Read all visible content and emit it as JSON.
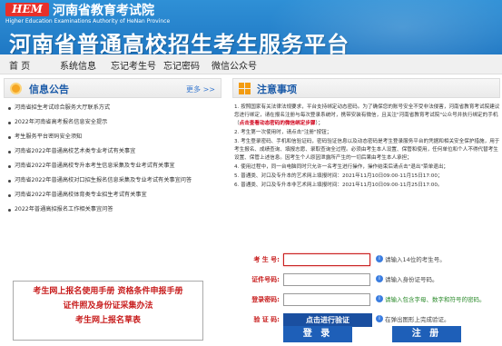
{
  "header": {
    "logo_text": "HEM",
    "org_name": "河南省教育考试院",
    "org_name_en": "Higher Education Examinations Authority of HeNan Province",
    "platform_title": "河南省普通高校招生考生服务平台"
  },
  "nav": {
    "items": [
      "首 页",
      "系统信息",
      "忘记考生号",
      "忘记密码",
      "微信公众号"
    ]
  },
  "announcements": {
    "title": "信息公告",
    "more": "更多 >>",
    "items": [
      "河南省招生考试综合服务大厅联系方式",
      "2022年河南省高考报名信息安全提示",
      "考生服务平台密码安全须知",
      "河南省2022年普通高校艺术类专业考试有关事宜",
      "河南省2022年普通高校专升本考生信息采集及专业考试有关事宜",
      "河南省2022年普通高校对口招生报名信息采集及专业考试有关事宜问答",
      "河南省2022年普通高校体育类专业招生考试有关事宜",
      "2022年普通高招报名工作相关事宜问答"
    ]
  },
  "links": {
    "line1": "考生网上报名使用手册  资格条件申报手册",
    "line2": "证件照及身份证采集办法",
    "line3": "考生网上报名草表"
  },
  "notes": {
    "title": "注意事项",
    "n1_pre": "1. 按照国家有关法律法规要求，平台支持绑定动态密码。为了确保您的账号安全不受非法侵害，河南省教育考试院建议您进行绑定，请在报名注册与每次登录系统时，携带安装有微信，且关注\"河南省教育考试院\"公众号并执行绑定的手机（",
    "n1_red": "点击查看动态密码的微信绑定步骤",
    "n1_post": "）；",
    "n2": "2. 考生第一次使用时，请点击\"注册\"按钮；",
    "n3": "3. 考生登录密码、手机和信验证码，密码验证信息以及动态密码是考生登录服务平台的凭据和相关安全保护措施，用于考生报名、成绩查询、填报志愿、录取查询全过程。必须由考生本人设置、保管和使用，任何单位和个人不得代替考生设置、保管上述信息。因考生个人原因泄露所产生的一切后果由考生本人承担；",
    "n4": "4. 使用过程中，同一台电脑同时只允许一名考生进行操作，操作结束后请点击\"退出\"菜单退出；",
    "n5": "5. 普通类、对口及专升本的艺术网上填报时间：2021年11月10日09:00-11月15日17:00；",
    "n6": "6. 普通类、对口及专升本非艺术网上填报时间：2021年11月10日09:00-11月25日17:00。"
  },
  "form": {
    "exam_no_label": "考 生 号:",
    "exam_no_hint": "请输入14位的考生号。",
    "id_label": "证件号码:",
    "id_hint": "请输入身份证号码。",
    "pwd_label": "登录密码:",
    "pwd_hint": "请输入包含字母、数字和符号的密码。",
    "captcha_label": "验 证 码:",
    "captcha_button": "点击进行验证",
    "captcha_hint": "在弹出图形上完成验证。",
    "login": "登 录",
    "register": "注 册"
  },
  "colors": {
    "brand_blue": "#1f78c4",
    "accent_red": "#c81e1e",
    "button_blue": "#1e5fb8"
  }
}
